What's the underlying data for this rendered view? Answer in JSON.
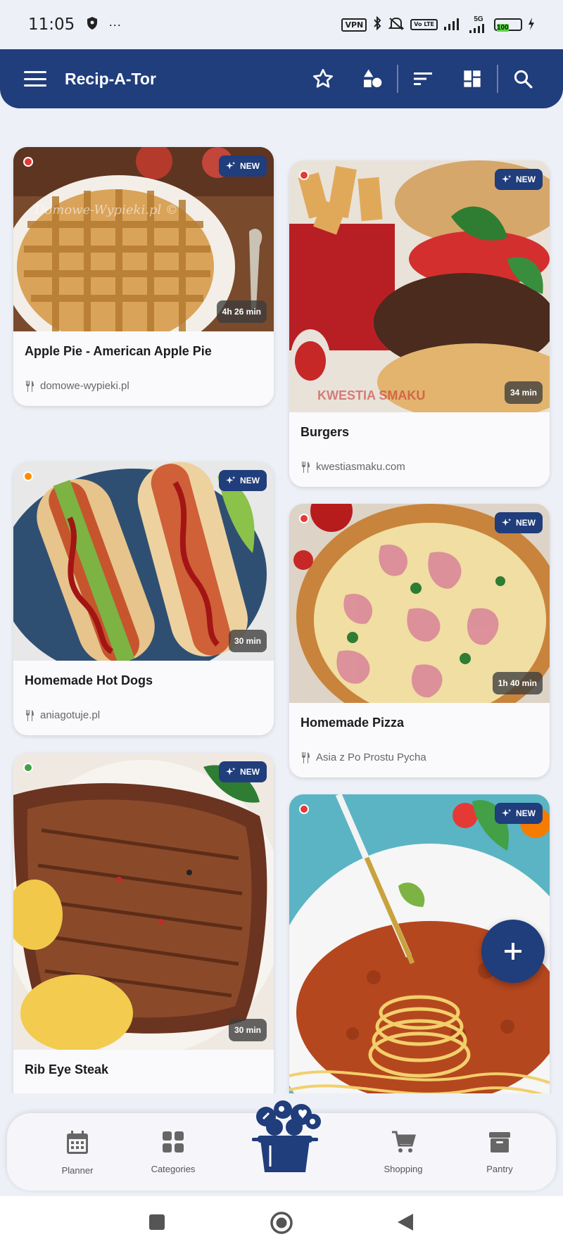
{
  "status_bar": {
    "time": "11:05",
    "more": "···",
    "vpn": "VPN",
    "volte": "Vo LTE",
    "network": "5G",
    "battery": "100"
  },
  "app_bar": {
    "title": "Recip-A-Tor",
    "icons": [
      "menu-icon",
      "star-icon",
      "shapes-icon",
      "sort-icon",
      "dashboard-icon",
      "search-icon"
    ]
  },
  "recipes": [
    {
      "title": "Apple Pie - American Apple Pie",
      "source": "domowe-wypieki.pl",
      "time": "4h 26 min",
      "badge": "NEW",
      "dot_color": "#e53935"
    },
    {
      "title": "Burgers",
      "source": "kwestiasmaku.com",
      "time": "34 min",
      "badge": "NEW",
      "dot_color": "#e53935"
    },
    {
      "title": "Homemade Hot Dogs",
      "source": "aniagotuje.pl",
      "time": "30 min",
      "badge": "NEW",
      "dot_color": "#fb8c00"
    },
    {
      "title": "Homemade Pizza",
      "source": "Asia z Po Prostu Pycha",
      "time": "1h 40 min",
      "badge": "NEW",
      "dot_color": "#e53935"
    },
    {
      "title": "Rib Eye Steak",
      "source": "",
      "time": "30 min",
      "badge": "NEW",
      "dot_color": "#43a047"
    },
    {
      "title": "",
      "source": "",
      "time": "",
      "badge": "NEW",
      "dot_color": "#e53935"
    }
  ],
  "watermarks": {
    "apple_pie": "Domowe-Wypieki.pl ©",
    "burger": "KWESTIA SMAKU"
  },
  "fab": {
    "icon": "plus-icon"
  },
  "bottom_nav": {
    "items": [
      {
        "label": "Planner",
        "icon": "calendar-icon"
      },
      {
        "label": "Categories",
        "icon": "grid-icon"
      },
      {
        "label": "Shopping",
        "icon": "cart-icon"
      },
      {
        "label": "Pantry",
        "icon": "archive-icon"
      }
    ],
    "center_icon": "cooking-pot-logo-icon"
  },
  "colors": {
    "primary": "#203d7c",
    "background": "#eef0f7",
    "card": "#fafafc"
  }
}
